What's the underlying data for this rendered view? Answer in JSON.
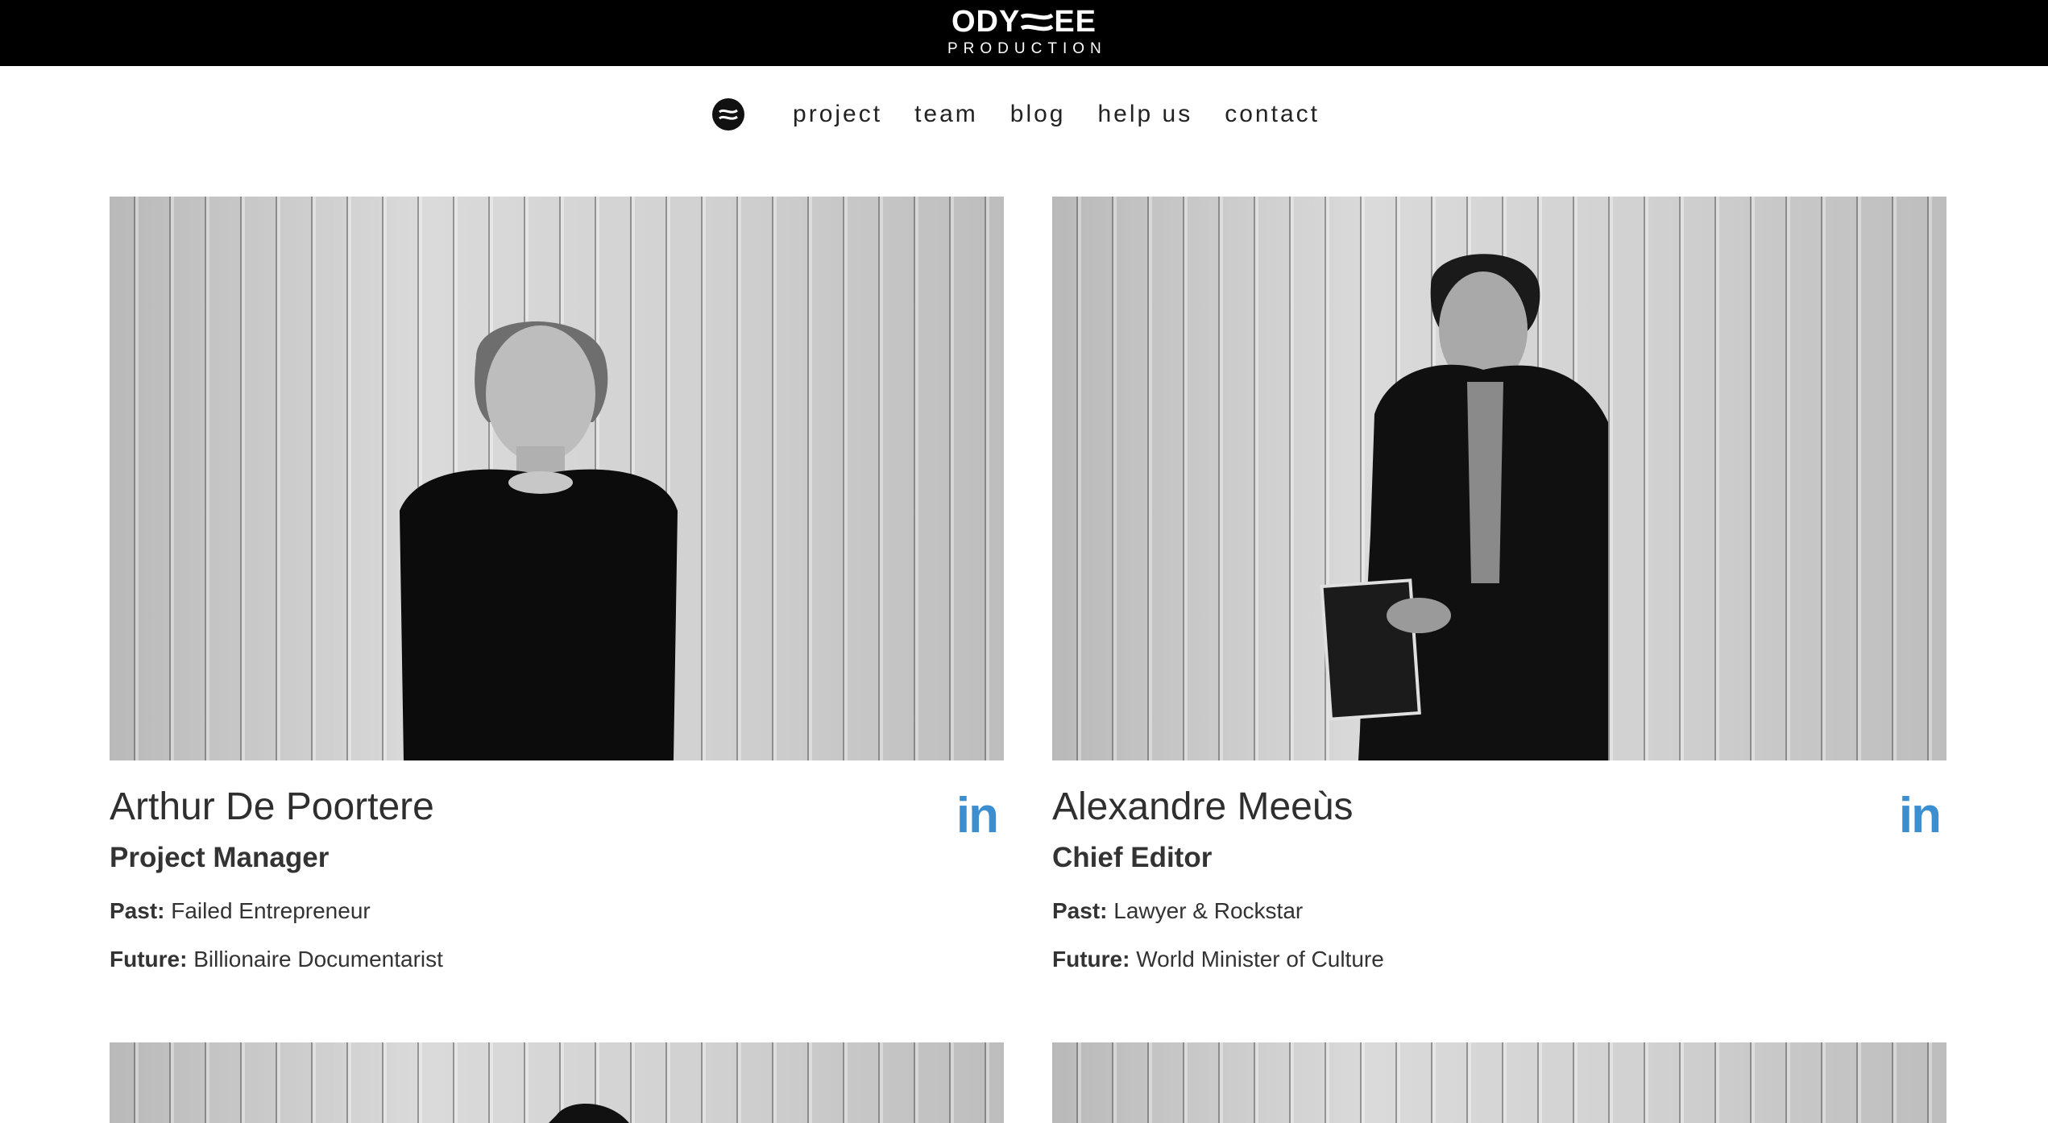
{
  "header": {
    "logo_main": "ODY",
    "logo_tail": "EE",
    "logo_sub": "PRODUCTION",
    "background": "#000000"
  },
  "nav": {
    "items": [
      {
        "label": "project"
      },
      {
        "label": "team"
      },
      {
        "label": "blog"
      },
      {
        "label": "help us"
      },
      {
        "label": "contact"
      }
    ]
  },
  "team": {
    "members": [
      {
        "name": "Arthur De Poortere",
        "role": "Project Manager",
        "past_label": "Past:",
        "past": "Failed Entrepreneur",
        "future_label": "Future:",
        "future": "Billionaire Documentarist",
        "social": "in",
        "social_icon": "linkedin-icon"
      },
      {
        "name": "Alexandre Meeùs",
        "role": "Chief Editor",
        "past_label": "Past:",
        "past": "Lawyer & Rockstar",
        "future_label": "Future:",
        "future": "World Minister of Culture",
        "social": "in",
        "social_icon": "linkedin-icon"
      }
    ]
  },
  "colors": {
    "accent": "#3b8ed0",
    "text": "#333333"
  }
}
